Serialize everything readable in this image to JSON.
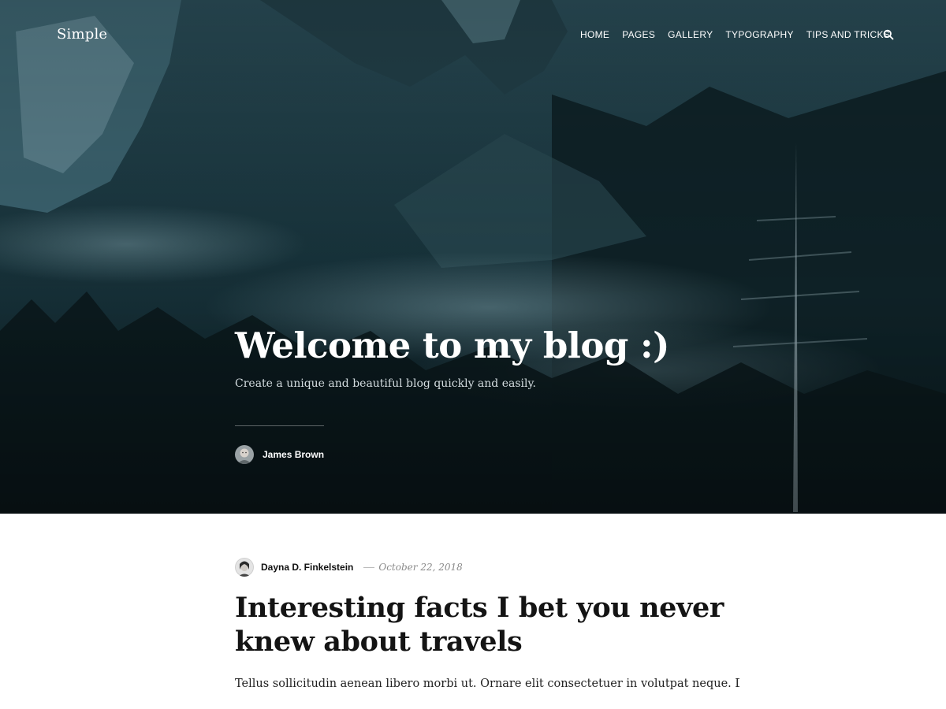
{
  "site": {
    "title": "Simple"
  },
  "nav": {
    "items": [
      {
        "label": "HOME"
      },
      {
        "label": "PAGES"
      },
      {
        "label": "GALLERY"
      },
      {
        "label": "TYPOGRAPHY"
      },
      {
        "label": "TIPS AND TRICKS"
      }
    ],
    "search_icon": "search-icon"
  },
  "hero": {
    "title": "Welcome to my blog :)",
    "subtitle": "Create a unique and beautiful blog quickly and easily.",
    "author": {
      "name": "James Brown",
      "avatar": "avatar-icon"
    }
  },
  "post": {
    "author": {
      "name": "Dayna D. Finkelstein",
      "avatar": "avatar-icon"
    },
    "date": "October 22, 2018",
    "title": "Interesting facts I bet you never knew about travels",
    "excerpt": "Tellus sollicitudin aenean libero morbi ut. Ornare elit consectetuer in volutpat neque. Dolor in"
  },
  "colors": {
    "hero_dark": "#10242b",
    "text_dark": "#141414",
    "meta_gray": "#8a8a8a"
  }
}
